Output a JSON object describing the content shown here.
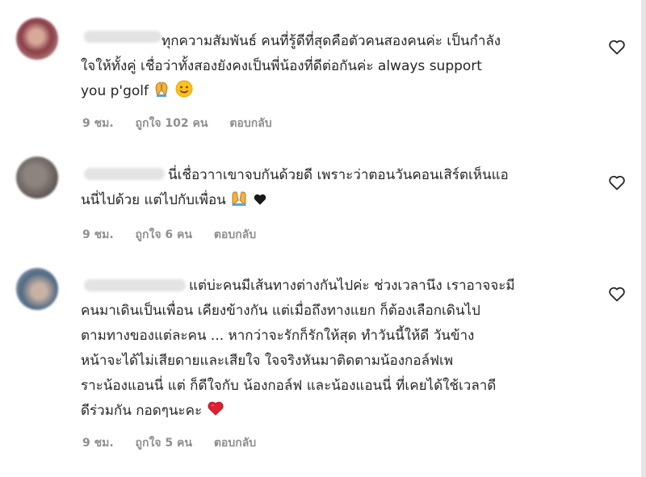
{
  "comments": [
    {
      "lines": [
        "ทุกความสัมพันธ์ คนที่รู้ดีที่สุดคือตัวคนสองคนค่ะ เป็นกำลัง",
        "ใจให้ทั้งคู่ เชื่อว่าทั้งสองยังคงเป็นพี่น้องที่ดีต่อกันค่ะ always support",
        "you p'golf"
      ],
      "time": "9 ชม.",
      "likes": "ถูกใจ 102 คน",
      "reply": "ตอบกลับ"
    },
    {
      "lines": [
        "นี่เชื่อวาาเขาจบกันด้วยดี เพราะว่าตอนวันคอนเสิร์ตเห็นแอ",
        "นนี่ไปด้วย แต่ไปกับเพื่อน"
      ],
      "time": "9 ชม.",
      "likes": "ถูกใจ 6 คน",
      "reply": "ตอบกลับ"
    },
    {
      "lines": [
        "แต่บ่ะคนมีเส้นทางต่างกันไปค่ะ ช่วงเวลานึง เราอาจจะมี",
        "คนมาเดินเป็นเพื่อน เคียงข้างกัน แต่เมื่อถึงทางแยก ก็ต้องเลือกเดินไป",
        "ตามทางของแต่ละคน ... หากว่าจะรักก็รักให้สุด ทำวันนี้ให้ดี วันข้าง",
        "หน้าจะได้ไม่เสียดายและเสียใจ ใจจริงหันมาติดตามน้องกอล์ฟเพ",
        "ราะน้องแอนนี่ แต่ ก็ดีใจกับ น้องกอล์ฟ และน้องแอนนี่ ที่เคยได้ใช้เวลาดี",
        "ดีร่วมกัน กอดๆนะคะ"
      ],
      "time": "9 ชม.",
      "likes": "ถูกใจ 5 คน",
      "reply": "ตอบกลับ"
    }
  ]
}
